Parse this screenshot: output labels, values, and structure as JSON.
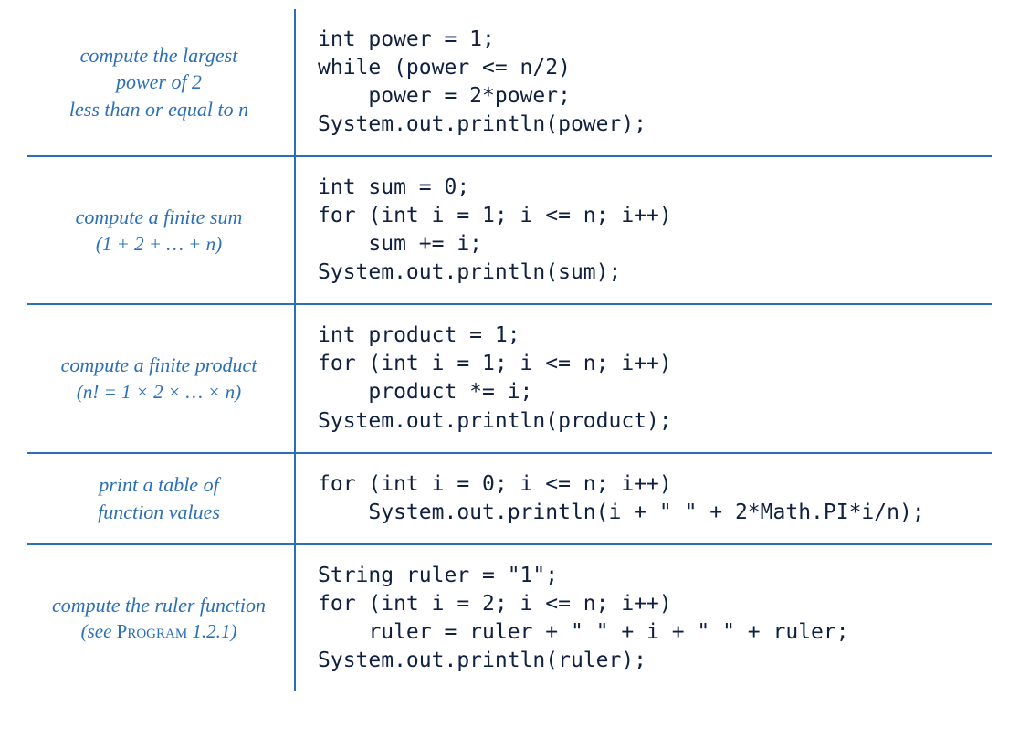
{
  "rows": [
    {
      "desc_lines": [
        "compute the largest",
        "power of 2",
        "less than or equal to n"
      ],
      "code": "int power = 1;\nwhile (power <= n/2)\n    power = 2*power;\nSystem.out.println(power);"
    },
    {
      "desc_lines": [
        "compute a finite sum",
        "(1 + 2 + … + n)"
      ],
      "code": "int sum = 0;\nfor (int i = 1; i <= n; i++)\n    sum += i;\nSystem.out.println(sum);"
    },
    {
      "desc_lines": [
        "compute a finite product",
        "(n! = 1 × 2 ×  …  × n)"
      ],
      "code": "int product = 1;\nfor (int i = 1; i <= n; i++)\n    product *= i;\nSystem.out.println(product);"
    },
    {
      "desc_lines": [
        "print a table of",
        "function values"
      ],
      "code": "for (int i = 0; i <= n; i++)\n    System.out.println(i + \" \" + 2*Math.PI*i/n);"
    },
    {
      "desc_lines": [
        "compute the ruler function"
      ],
      "ref_prefix": "(see ",
      "ref_program": "Program",
      "ref_suffix": " 1.2.1)",
      "code": "String ruler = \"1\";\nfor (int i = 2; i <= n; i++)\n    ruler = ruler + \" \" + i + \" \" + ruler;\nSystem.out.println(ruler);"
    }
  ]
}
